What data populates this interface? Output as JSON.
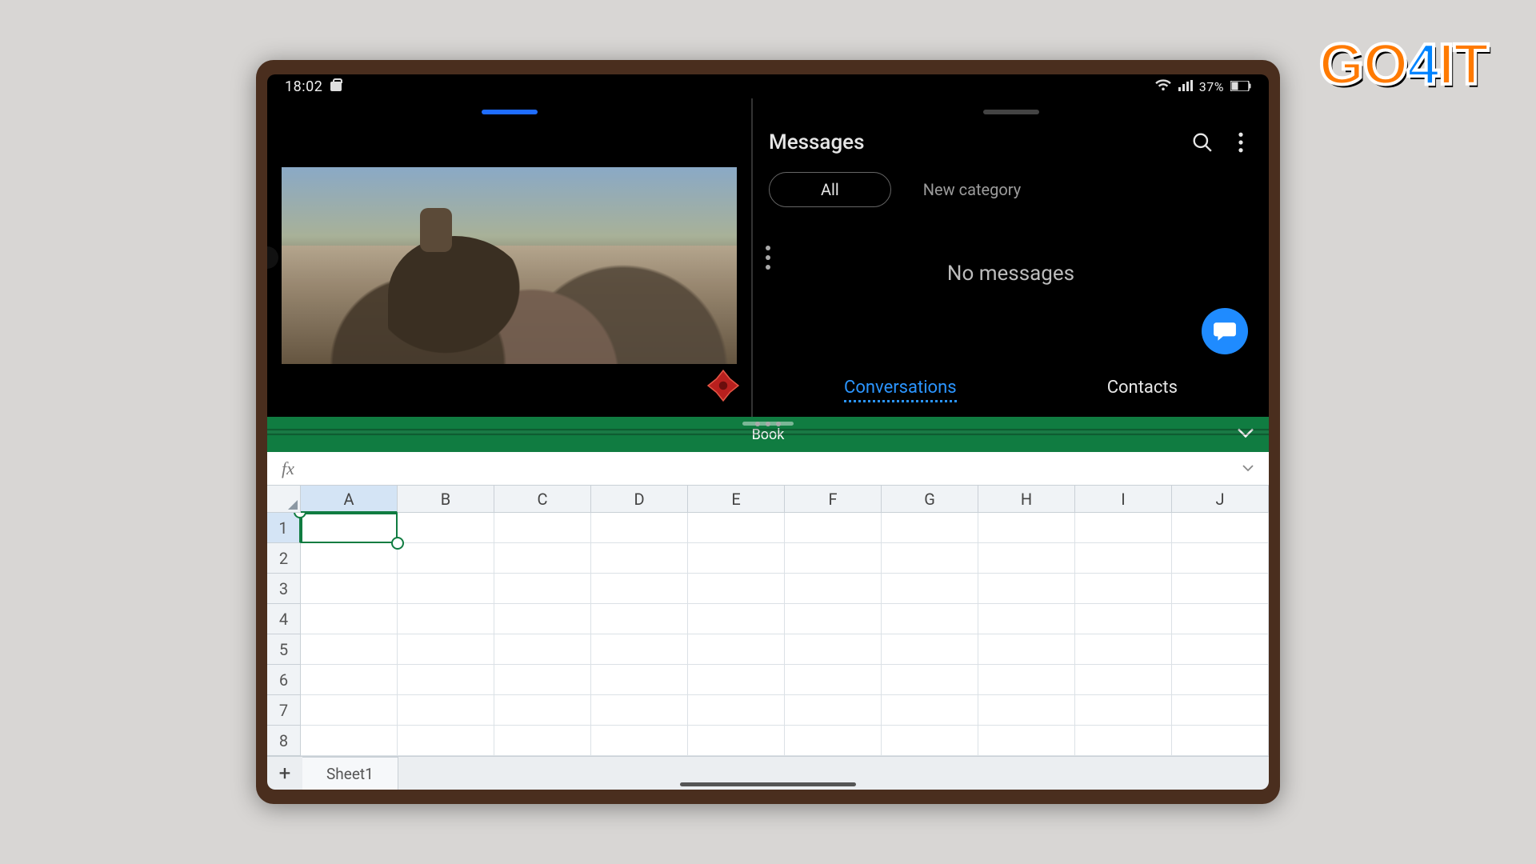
{
  "status": {
    "time": "18:02",
    "battery_text": "37%",
    "signal_icon": "wifi",
    "battery_icon": "battery"
  },
  "video": {
    "brand_icon_name": "ign-logo"
  },
  "messages": {
    "title": "Messages",
    "filter_all": "All",
    "new_category": "New category",
    "empty_text": "No messages",
    "tab_conversations": "Conversations",
    "tab_contacts": "Contacts"
  },
  "excel": {
    "doc_title": "Book",
    "fx_label": "fx",
    "columns": [
      "A",
      "B",
      "C",
      "D",
      "E",
      "F",
      "G",
      "H",
      "I",
      "J"
    ],
    "rows": [
      "1",
      "2",
      "3",
      "4",
      "5",
      "6",
      "7",
      "8"
    ],
    "selected_col": "A",
    "selected_row": "1",
    "sheet_tab": "Sheet1",
    "add_sheet": "+"
  },
  "watermark": {
    "go": "GO",
    "four": "4",
    "it": "IT"
  }
}
